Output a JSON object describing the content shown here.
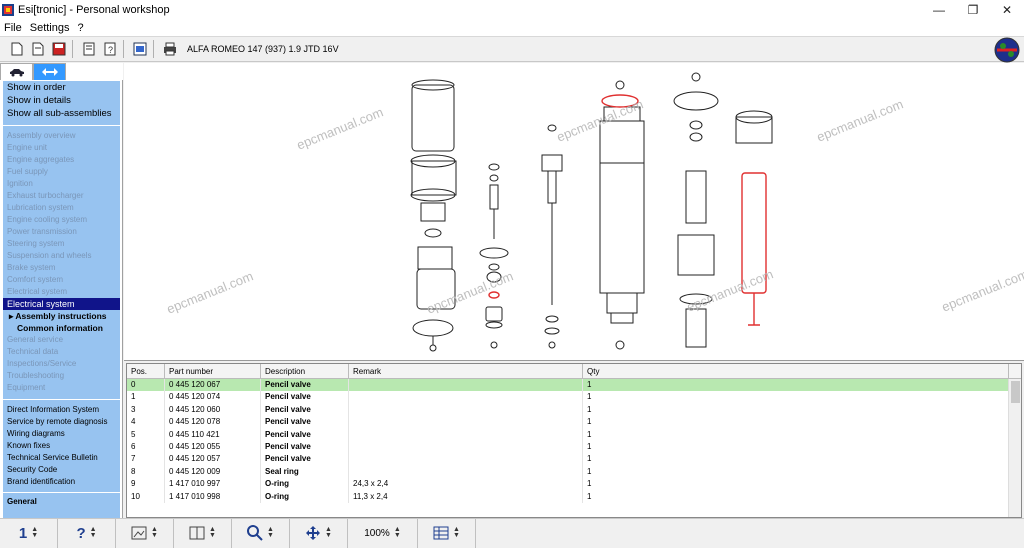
{
  "window": {
    "title": "Esi[tronic] - Personal workshop",
    "minimize_label": "—",
    "restore_label": "❐",
    "close_label": "✕"
  },
  "menu": [
    "File",
    "Settings",
    "?"
  ],
  "toolbar": {
    "vehicle": "ALFA ROMEO  147 (937) 1.9 JTD 16V"
  },
  "nav": {
    "top_links": [
      "Show in order",
      "Show in details",
      "Show all sub-assemblies"
    ],
    "assemblies": [
      "Assembly overview",
      "Engine unit",
      "Engine aggregates",
      "Fuel supply",
      "Ignition",
      "Exhaust turbocharger",
      "Lubrication system",
      "Engine cooling system",
      "Power transmission",
      "Steering system",
      "Suspension and wheels",
      "Brake system",
      "Comfort system",
      "Electrical system"
    ],
    "selected": "Electrical system",
    "sub_item": "Assembly instructions",
    "sub_item2": "Common information",
    "info_items": [
      "General service",
      "Technical data",
      "Inspections/Service",
      "Troubleshooting",
      "Equipment"
    ],
    "tools": [
      "Direct Information System",
      "Service by remote diagnosis",
      "Wiring diagrams",
      "Known fixes",
      "Technical Service Bulletin",
      "Security Code",
      "Brand identification"
    ],
    "general": "General"
  },
  "watermark": "epcmanual.com",
  "table": {
    "headers": [
      "Pos.",
      "Part number",
      "Description",
      "Remark",
      "Qty"
    ],
    "rows": [
      {
        "pos": "0",
        "part": "0 445 120 067",
        "desc": "Pencil valve",
        "remark": "",
        "qty": "1"
      },
      {
        "pos": "1",
        "part": "0 445 120 074",
        "desc": "Pencil valve",
        "remark": "",
        "qty": "1"
      },
      {
        "pos": "3",
        "part": "0 445 120 060",
        "desc": "Pencil valve",
        "remark": "",
        "qty": "1"
      },
      {
        "pos": "4",
        "part": "0 445 120 078",
        "desc": "Pencil valve",
        "remark": "",
        "qty": "1"
      },
      {
        "pos": "5",
        "part": "0 445 110 421",
        "desc": "Pencil valve",
        "remark": "",
        "qty": "1"
      },
      {
        "pos": "6",
        "part": "0 445 120 055",
        "desc": "Pencil valve",
        "remark": "",
        "qty": "1"
      },
      {
        "pos": "7",
        "part": "0 445 120 057",
        "desc": "Pencil valve",
        "remark": "",
        "qty": "1"
      },
      {
        "pos": "8",
        "part": "0 445 120 009",
        "desc": "Seal ring",
        "remark": "",
        "qty": "1"
      },
      {
        "pos": "9",
        "part": "1 417 010 997",
        "desc": "O-ring",
        "remark": "24,3 x 2,4",
        "qty": "1"
      },
      {
        "pos": "10",
        "part": "1 417 010 998",
        "desc": "O-ring",
        "remark": "11,3 x 2,4",
        "qty": "1"
      }
    ]
  },
  "statusbar": {
    "page": "1",
    "help": "?",
    "zoom": "100%"
  },
  "colors": {
    "nav_bg": "#97c3f0",
    "nav_selected": "#10148a",
    "row_selected": "#b8e8b0",
    "highlight_red": "#e03030"
  }
}
